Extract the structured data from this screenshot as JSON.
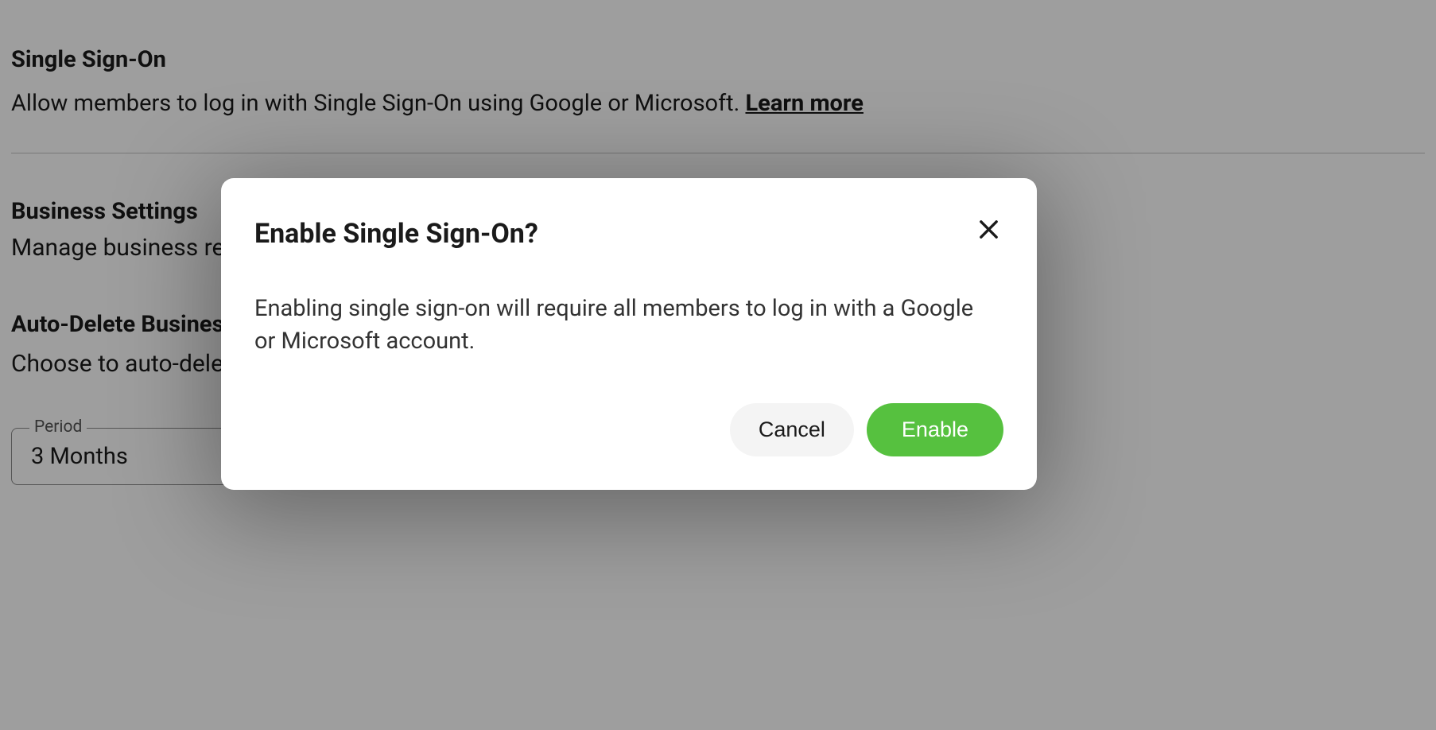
{
  "settings": {
    "sso": {
      "title": "Single Sign-On",
      "description": "Allow members to log in with Single Sign-On using Google or Microsoft. ",
      "learn_more": "Learn more"
    },
    "business": {
      "title": "Business Settings",
      "description": "Manage business related settings."
    },
    "auto_delete": {
      "title": "Auto-Delete Business",
      "description": "Choose to auto-delete",
      "period": {
        "legend": "Period",
        "value": "3 Months"
      }
    }
  },
  "dialog": {
    "title": "Enable Single Sign-On?",
    "body": "Enabling single sign-on will require all members to log in with a Google or Microsoft account.",
    "cancel": "Cancel",
    "confirm": "Enable"
  }
}
